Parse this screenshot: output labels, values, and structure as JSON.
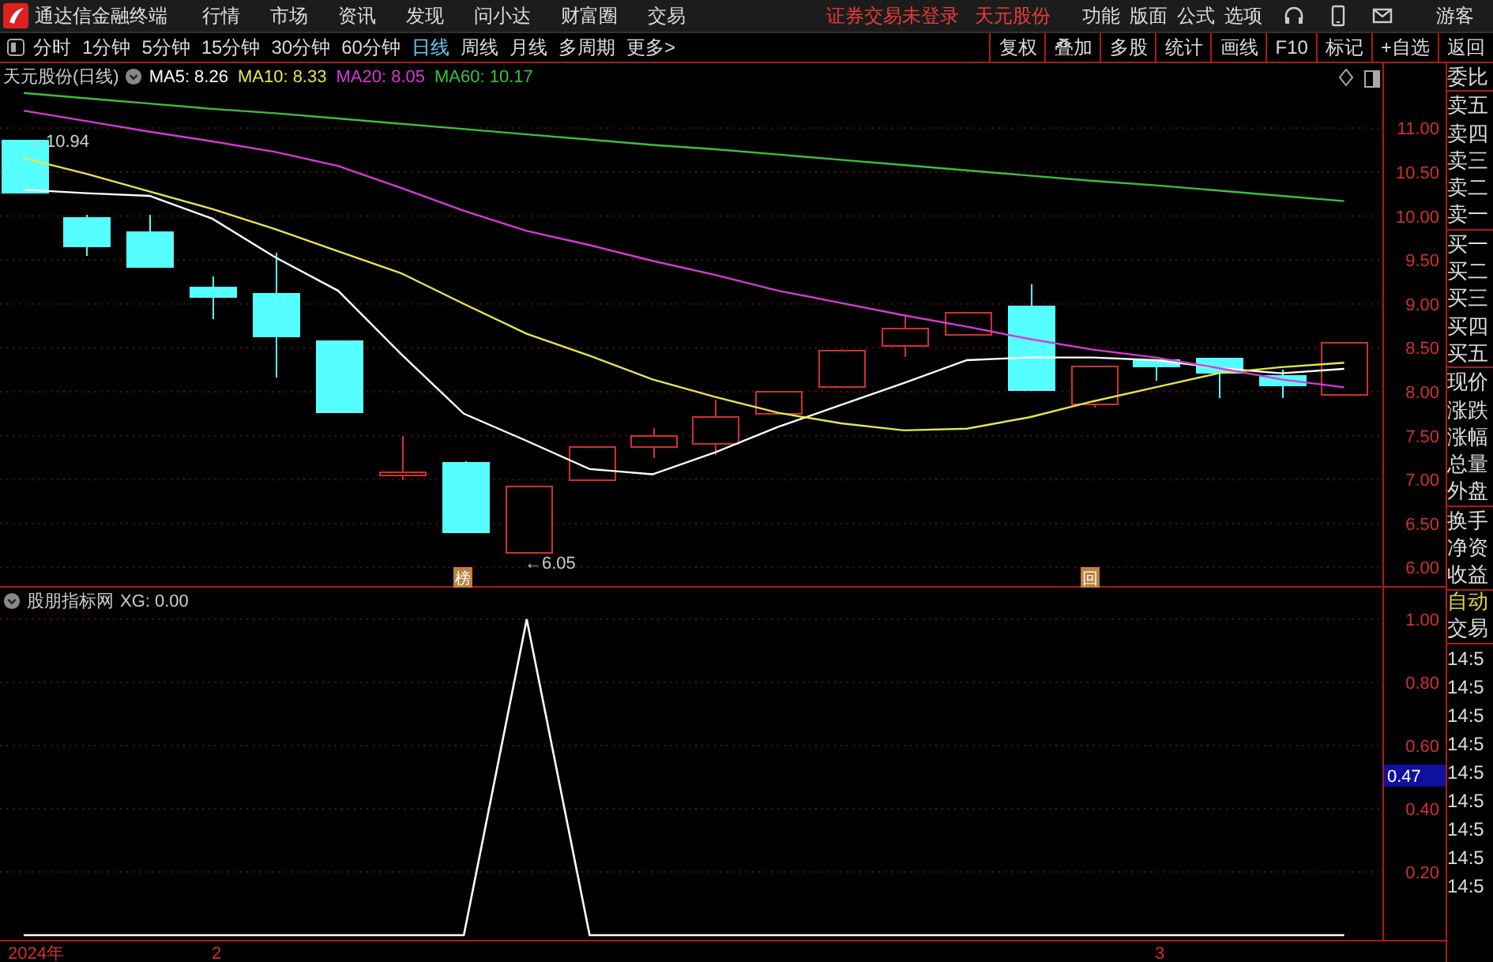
{
  "menu_bar": {
    "app_title": "通达信金融终端",
    "menus": [
      "行情",
      "市场",
      "资讯",
      "发现",
      "问小达",
      "财富圈",
      "交易"
    ],
    "login_status": "证券交易未登录",
    "stock_name": "天元股份",
    "tools": [
      "功能",
      "版面",
      "公式",
      "选项"
    ],
    "user": "游客"
  },
  "period_bar": {
    "periods": [
      {
        "label": "分时",
        "selected": false
      },
      {
        "label": "1分钟",
        "selected": false
      },
      {
        "label": "5分钟",
        "selected": false
      },
      {
        "label": "15分钟",
        "selected": false
      },
      {
        "label": "30分钟",
        "selected": false
      },
      {
        "label": "60分钟",
        "selected": false
      },
      {
        "label": "日线",
        "selected": true
      },
      {
        "label": "周线",
        "selected": false
      },
      {
        "label": "月线",
        "selected": false
      },
      {
        "label": "多周期",
        "selected": false
      },
      {
        "label": "更多>",
        "selected": false
      }
    ],
    "actions": [
      "复权",
      "叠加",
      "多股",
      "统计",
      "画线",
      "F10",
      "标记",
      "+自选",
      "返回"
    ]
  },
  "price_chart": {
    "title": "天元股份(日线)",
    "high_label": "←10.94",
    "low_label": "←6.05",
    "markers": [
      "榜",
      "回"
    ],
    "readouts": [
      ": 8.26",
      ": 8.33",
      ": 8.05",
      ": 10.17"
    ],
    "chart_data": {
      "type": "line",
      "grid": true,
      "ylim": [
        5.77,
        11.74
      ],
      "yticks": [
        {
          "value": 11,
          "label": "11.00"
        },
        {
          "value": 10.5,
          "label": "10.50"
        },
        {
          "value": 10,
          "label": "10.00"
        },
        {
          "value": 9.5,
          "label": "9.50"
        },
        {
          "value": 9,
          "label": "9.00"
        },
        {
          "value": 8.5,
          "label": "8.50"
        },
        {
          "value": 8,
          "label": "8.00"
        },
        {
          "value": 7.5,
          "label": "7.50"
        },
        {
          "value": 7,
          "label": "7.00"
        },
        {
          "value": 6.5,
          "label": "6.50"
        },
        {
          "value": 6,
          "label": "6.00"
        }
      ],
      "series": [
        {
          "name": "MA5",
          "color": "#ffffff",
          "values": [
            10.3,
            10.26,
            10.23,
            9.97,
            9.53,
            9.15,
            8.43,
            7.75,
            7.44,
            7.12,
            7.06,
            7.31,
            7.6,
            7.85,
            8.1,
            8.36,
            8.39,
            8.39,
            8.36,
            8.27,
            8.21,
            8.26
          ]
        },
        {
          "name": "MA10",
          "color": "#e6e64c",
          "values": [
            10.66,
            10.48,
            10.28,
            10.08,
            9.85,
            9.6,
            9.35,
            9.0,
            8.66,
            8.41,
            8.14,
            7.94,
            7.76,
            7.64,
            7.56,
            7.58,
            7.71,
            7.89,
            8.05,
            8.21,
            8.28,
            8.33
          ]
        },
        {
          "name": "MA20",
          "color": "#d63ad6",
          "values": [
            11.2,
            11.08,
            10.96,
            10.85,
            10.73,
            10.57,
            10.32,
            10.06,
            9.83,
            9.67,
            9.49,
            9.33,
            9.15,
            9.01,
            8.87,
            8.74,
            8.6,
            8.48,
            8.39,
            8.27,
            8.14,
            8.05
          ]
        },
        {
          "name": "MA60",
          "color": "#3cc03c",
          "values": [
            11.4,
            11.34,
            11.28,
            11.22,
            11.17,
            11.11,
            11.05,
            10.99,
            10.93,
            10.87,
            10.81,
            10.76,
            10.7,
            10.64,
            10.58,
            10.52,
            10.46,
            10.4,
            10.35,
            10.29,
            10.23,
            10.17
          ]
        }
      ]
    }
  },
  "indicator": {
    "title": "股朋指标网",
    "readout": ": 0.00",
    "cursor_value": "0.47",
    "chart_data": {
      "type": "line",
      "grid": true,
      "ylim": [
        0,
        1.1
      ],
      "yticks": [
        {
          "value": 1,
          "label": "1.00"
        },
        {
          "value": 0.8,
          "label": "0.80"
        },
        {
          "value": 0.6,
          "label": "0.60"
        },
        {
          "value": 0.4,
          "label": "0.40"
        },
        {
          "value": 0.2,
          "label": "0.20"
        }
      ],
      "series": [
        {
          "name": "XG",
          "color": "#ffffff",
          "values": [
            0,
            0,
            0,
            0,
            0,
            0,
            0,
            0,
            1,
            0,
            0,
            0,
            0,
            0,
            0,
            0,
            0,
            0,
            0,
            0,
            0,
            0
          ]
        }
      ]
    }
  },
  "date_axis": [
    "2024年",
    "2",
    "3"
  ],
  "quote_panel": {
    "groups": [
      [
        "委比"
      ],
      [
        "卖五",
        "卖四",
        "卖三",
        "卖二",
        "卖一"
      ],
      [
        "买一",
        "买二",
        "买三",
        "买四",
        "买五"
      ],
      [
        "现价",
        "涨跌",
        "涨幅",
        "总量",
        "外盘"
      ],
      [
        "换手",
        "净资",
        "收益"
      ]
    ],
    "trade": [
      {
        "label": "自动",
        "active": true
      },
      {
        "label": "交易",
        "active": false
      }
    ],
    "times": [
      "14:5",
      "14:5",
      "14:5",
      "14:5",
      "14:5",
      "14:5",
      "14:5",
      "14:5",
      "14:5"
    ]
  }
}
